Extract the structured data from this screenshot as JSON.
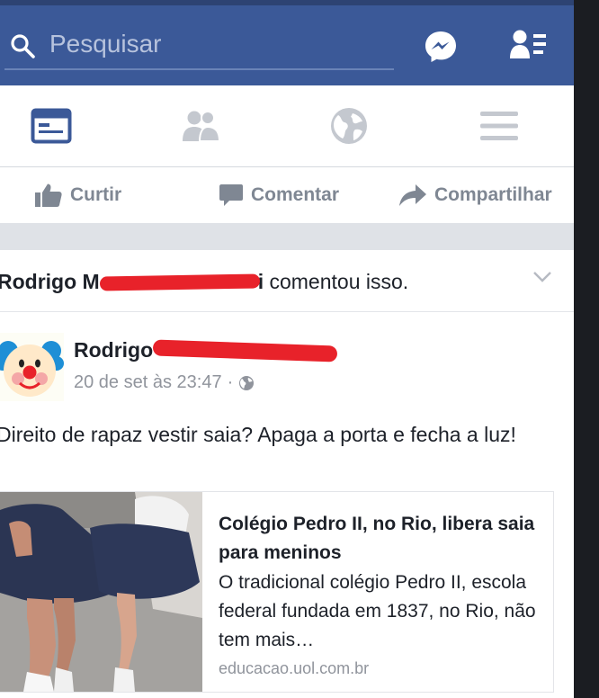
{
  "search": {
    "placeholder": "Pesquisar"
  },
  "icons": {
    "search": "search-icon",
    "messenger": "messenger-icon",
    "friend_requests": "friend-requests-icon",
    "news_feed": "news-feed-icon",
    "friends": "friends-icon",
    "notifications": "globe-icon",
    "menu": "menu-icon"
  },
  "colors": {
    "header": "#3b5998",
    "active_tab": "#3b5998",
    "inactive": "#c4c8cf",
    "redaction": "#e8222a"
  },
  "actions": {
    "like": "Curtir",
    "comment": "Comentar",
    "share": "Compartilhar"
  },
  "story": {
    "actor": "Rodrigo M",
    "action": "comentou isso.",
    "actor_suffix": "i"
  },
  "post": {
    "author": "Rodrigo",
    "date": "20 de set às 23:47",
    "separator": "·",
    "privacy": "globe-icon",
    "text": "Direito de rapaz vestir saia? Apaga a porta e fecha a luz!"
  },
  "link": {
    "title": "Colégio Pedro II, no Rio, libera saia para meninos",
    "description": "O tradicional colégio Pedro II, escola federal fundada em 1837, no Rio, não tem mais…",
    "domain": "educacao.uol.com.br"
  }
}
